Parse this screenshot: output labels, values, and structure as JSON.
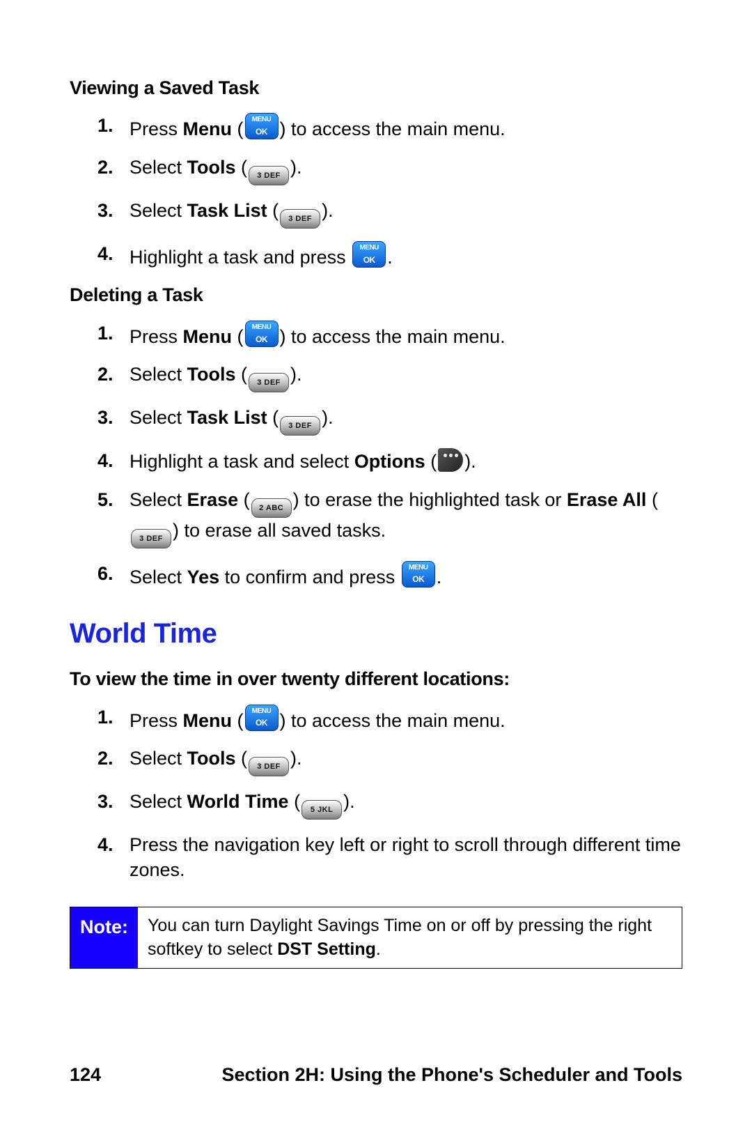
{
  "headings": {
    "viewing": "Viewing a Saved Task",
    "deleting": "Deleting a Task",
    "world_time": "World Time",
    "world_time_intro": "To view the time in over twenty different locations:"
  },
  "icons": {
    "menu_ok_line1": "MENU",
    "menu_ok_line2": "OK",
    "key_2abc": "2 ABC",
    "key_3def": "3 DEF",
    "key_5jkl": "5 JKL"
  },
  "viewing_steps": {
    "s1_a": "Press ",
    "s1_bold": "Menu",
    "s1_b": " (",
    "s1_c": ") to access the main menu.",
    "s2_a": "Select ",
    "s2_bold": "Tools",
    "s2_b": " (",
    "s2_c": ").",
    "s3_a": "Select ",
    "s3_bold": "Task List",
    "s3_b": " (",
    "s3_c": ").",
    "s4_a": "Highlight a task and press ",
    "s4_b": "."
  },
  "deleting_steps": {
    "s1_a": "Press ",
    "s1_bold": "Menu",
    "s1_b": " (",
    "s1_c": ") to access the main menu.",
    "s2_a": "Select ",
    "s2_bold": "Tools",
    "s2_b": " (",
    "s2_c": ").",
    "s3_a": "Select ",
    "s3_bold": "Task List",
    "s3_b": " (",
    "s3_c": ").",
    "s4_a": "Highlight a task and select ",
    "s4_bold": "Options",
    "s4_b": " (",
    "s4_c": ").",
    "s5_a": "Select ",
    "s5_bold1": "Erase",
    "s5_b": " (",
    "s5_c": ") to erase the highlighted task or ",
    "s5_bold2": "Erase All",
    "s5_d": " (",
    "s5_e": ") to erase all saved tasks.",
    "s6_a": "Select ",
    "s6_bold": "Yes",
    "s6_b": " to confirm and press ",
    "s6_c": "."
  },
  "world_steps": {
    "s1_a": "Press ",
    "s1_bold": "Menu",
    "s1_b": " (",
    "s1_c": ") to access the main menu.",
    "s2_a": "Select ",
    "s2_bold": "Tools",
    "s2_b": " (",
    "s2_c": ").",
    "s3_a": "Select ",
    "s3_bold": "World Time",
    "s3_b": " (",
    "s3_c": ").",
    "s4": "Press the navigation key left or right to scroll through different time zones."
  },
  "note": {
    "label": "Note:",
    "text_a": "You can turn Daylight Savings Time on or off by pressing the right softkey to select ",
    "text_bold": "DST Setting",
    "text_b": "."
  },
  "footer": {
    "page_number": "124",
    "section": "Section 2H: Using the Phone's Scheduler and Tools"
  }
}
